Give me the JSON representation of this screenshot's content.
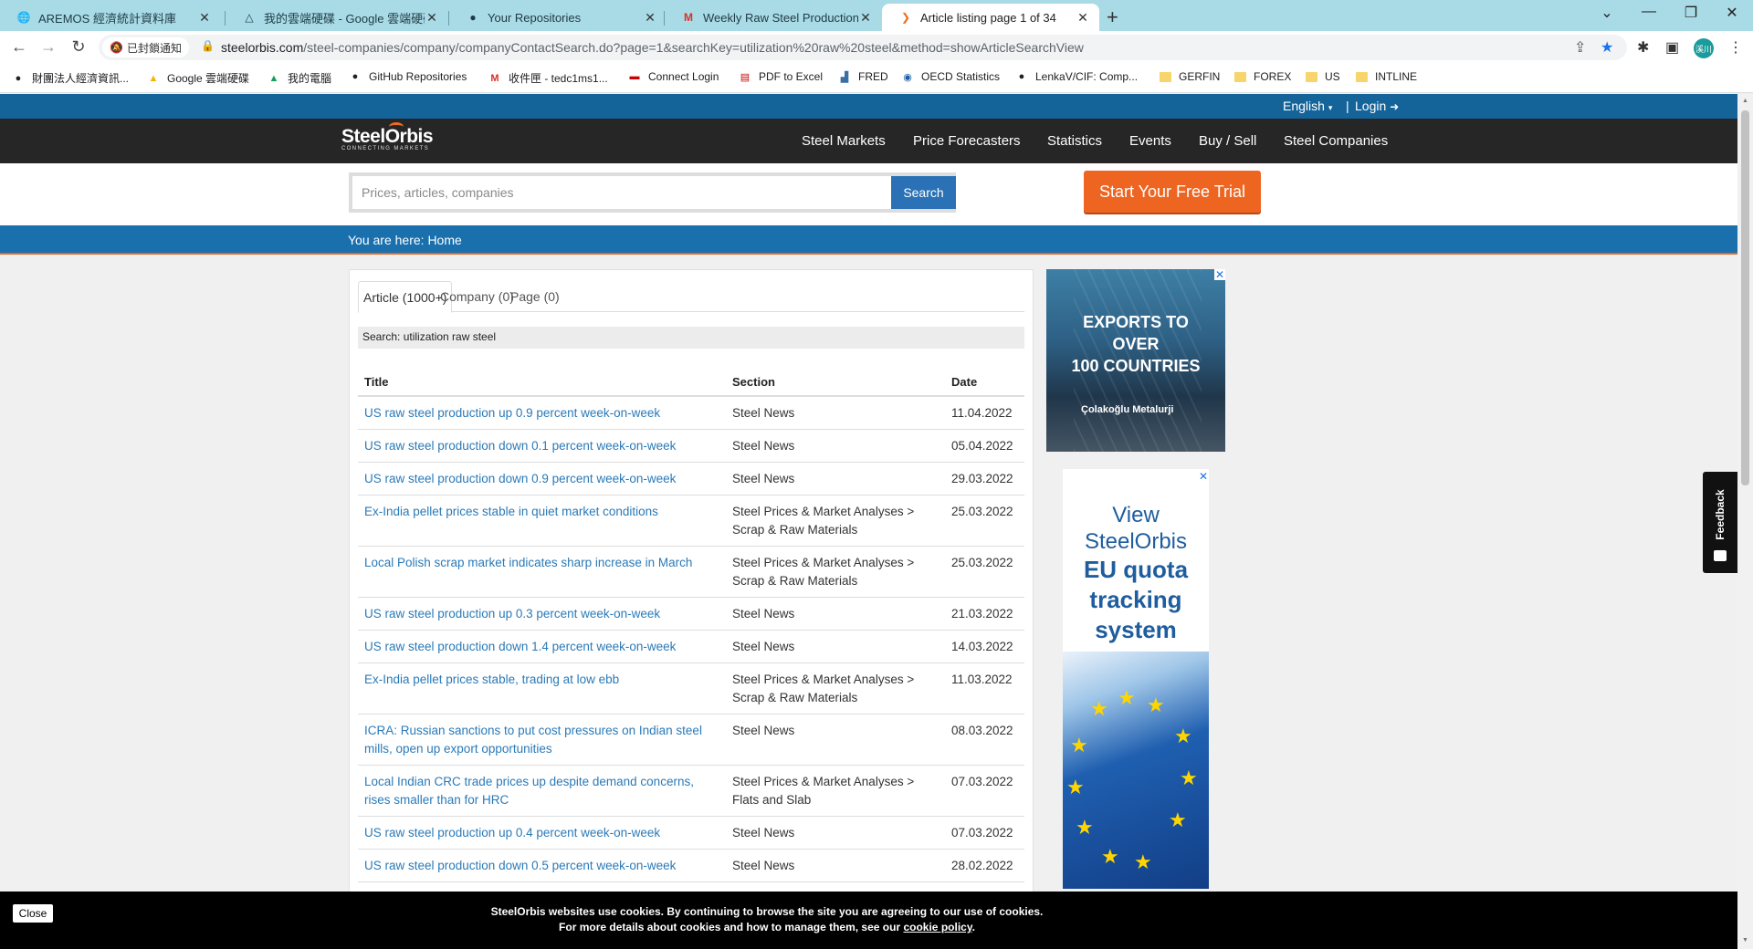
{
  "browser": {
    "tabs": [
      {
        "title": "AREMOS 經濟統計資料庫",
        "icon": "globe-icon"
      },
      {
        "title": "我的雲端硬碟 - Google 雲端硬碟",
        "icon": "google-drive-icon"
      },
      {
        "title": "Your Repositories",
        "icon": "github-icon"
      },
      {
        "title": "Weekly Raw Steel Production -",
        "icon": "gmail-icon"
      },
      {
        "title": "Article listing page 1 of 34",
        "icon": "steelorbis-icon",
        "active": true
      }
    ],
    "notification_chip": "已封鎖通知",
    "url_host": "steelorbis.com",
    "url_path": "/steel-companies/company/companyContactSearch.do?page=1&searchKey=utilization%20raw%20steel&method=showArticleSearchView",
    "profile_initials": "溪川",
    "bookmarks": [
      {
        "label": "財團法人經濟資訊...",
        "icon": "globe-icon"
      },
      {
        "label": "Google 雲端硬碟",
        "icon": "google-drive-icon"
      },
      {
        "label": "我的電腦",
        "icon": "google-drive-icon"
      },
      {
        "label": "GitHub Repositories",
        "icon": "github-icon"
      },
      {
        "label": "收件匣 - tedc1ms1...",
        "icon": "gmail-icon"
      },
      {
        "label": "Connect Login",
        "icon": "flag-icon"
      },
      {
        "label": "PDF to Excel",
        "icon": "pdf-icon"
      },
      {
        "label": "FRED",
        "icon": "chart-icon"
      },
      {
        "label": "OECD Statistics",
        "icon": "oecd-icon"
      },
      {
        "label": "LenkaV/CIF: Comp...",
        "icon": "github-icon"
      },
      {
        "label": "GERFIN",
        "icon": "folder-icon"
      },
      {
        "label": "FOREX",
        "icon": "folder-icon"
      },
      {
        "label": "US",
        "icon": "folder-icon"
      },
      {
        "label": "INTLINE",
        "icon": "folder-icon"
      }
    ]
  },
  "site": {
    "language": "English",
    "login": "Login",
    "logo_text": "SteelOrbis",
    "logo_tagline": "CONNECTING MARKETS",
    "nav": [
      "Steel Markets",
      "Price Forecasters",
      "Statistics",
      "Events",
      "Buy / Sell",
      "Steel Companies"
    ],
    "search_placeholder": "Prices, articles, companies",
    "search_button": "Search",
    "trial_button": "Start Your Free Trial",
    "breadcrumb": "You are here: Home"
  },
  "results": {
    "tabs": [
      "Article (1000+)",
      "Company (0)",
      "Page (0)"
    ],
    "search_label": "Search: utilization raw steel",
    "columns": [
      "Title",
      "Section",
      "Date"
    ],
    "rows": [
      {
        "title": "US raw steel production up 0.9 percent week-on-week",
        "section": "Steel News",
        "date": "11.04.2022"
      },
      {
        "title": "US raw steel production down 0.1 percent week-on-week",
        "section": "Steel News",
        "date": "05.04.2022"
      },
      {
        "title": "US raw steel production down 0.9 percent week-on-week",
        "section": "Steel News",
        "date": "29.03.2022"
      },
      {
        "title": "Ex-India pellet prices stable in quiet market conditions",
        "section": "Steel Prices & Market Analyses > Scrap & Raw Materials",
        "date": "25.03.2022"
      },
      {
        "title": "Local Polish scrap market indicates sharp increase in March",
        "section": "Steel Prices & Market Analyses > Scrap & Raw Materials",
        "date": "25.03.2022"
      },
      {
        "title": "US raw steel production up 0.3 percent week-on-week",
        "section": "Steel News",
        "date": "21.03.2022"
      },
      {
        "title": "US raw steel production down 1.4 percent week-on-week",
        "section": "Steel News",
        "date": "14.03.2022"
      },
      {
        "title": "Ex-India pellet prices stable, trading at low ebb",
        "section": "Steel Prices & Market Analyses > Scrap & Raw Materials",
        "date": "11.03.2022"
      },
      {
        "title": "ICRA: Russian sanctions to put cost pressures on Indian steel mills, open up export opportunities",
        "section": "Steel News",
        "date": "08.03.2022"
      },
      {
        "title": "Local Indian CRC trade prices up despite demand concerns, rises smaller than for HRC",
        "section": "Steel Prices & Market Analyses > Flats and Slab",
        "date": "07.03.2022"
      },
      {
        "title": "US raw steel production up 0.4 percent week-on-week",
        "section": "Steel News",
        "date": "07.03.2022"
      },
      {
        "title": "US raw steel production down 0.5 percent week-on-week",
        "section": "Steel News",
        "date": "28.02.2022"
      }
    ]
  },
  "ads": {
    "ad1_text": [
      "EXPORTS TO",
      "OVER",
      "100 COUNTRIES"
    ],
    "ad1_brand": "Çolakoğlu Metalurji",
    "ad2_text": [
      "View",
      "SteelOrbis"
    ],
    "ad2_bold": [
      "EU quota",
      "tracking",
      "system"
    ]
  },
  "feedback_label": "Feedback",
  "cookie": {
    "close": "Close",
    "line1": "SteelOrbis websites use cookies. By continuing to browse the site you are agreeing to our use of cookies.",
    "line2_prefix": "For more details about cookies and how to manage them, see our",
    "line2_link": "cookie policy",
    "line2_suffix": "."
  }
}
